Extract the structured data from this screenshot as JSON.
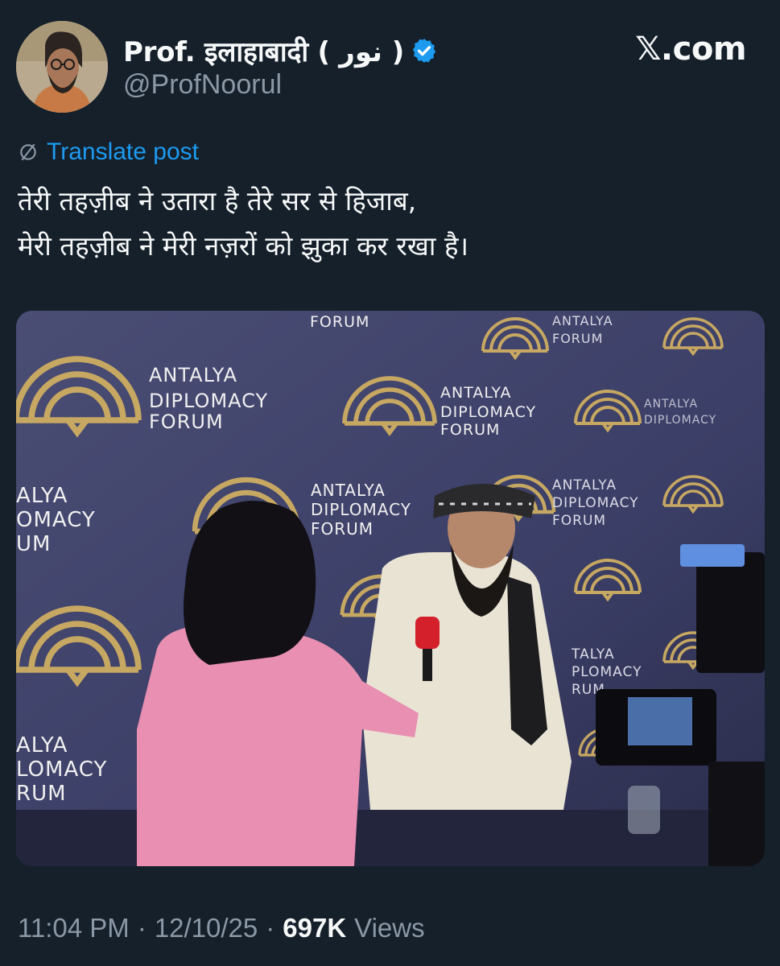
{
  "author": {
    "name": "Prof. इलाहाबादी ( نور )",
    "handle": "@ProfNoorul",
    "verified": true,
    "avatar_icon": "profile-photo"
  },
  "brand": "𝕏.com",
  "translate_label": "Translate post",
  "post": {
    "lines": [
      "तेरी तहज़ीब ने उतारा है तेरे सर से हिजाब,",
      "मेरी तहज़ीब ने मेरी नज़रों को झुका कर रखा है।"
    ]
  },
  "media": {
    "backdrop_text": [
      "ANTALYA",
      "DIPLOMACY",
      "FORUM"
    ]
  },
  "meta": {
    "time": "11:04 PM",
    "separator": "·",
    "date": "12/10/25",
    "views_count": "697K",
    "views_label": "Views"
  },
  "colors": {
    "background": "#15202b",
    "accent": "#1d9bf0",
    "muted": "#8b98a5",
    "logo_gold": "#c7a862"
  }
}
